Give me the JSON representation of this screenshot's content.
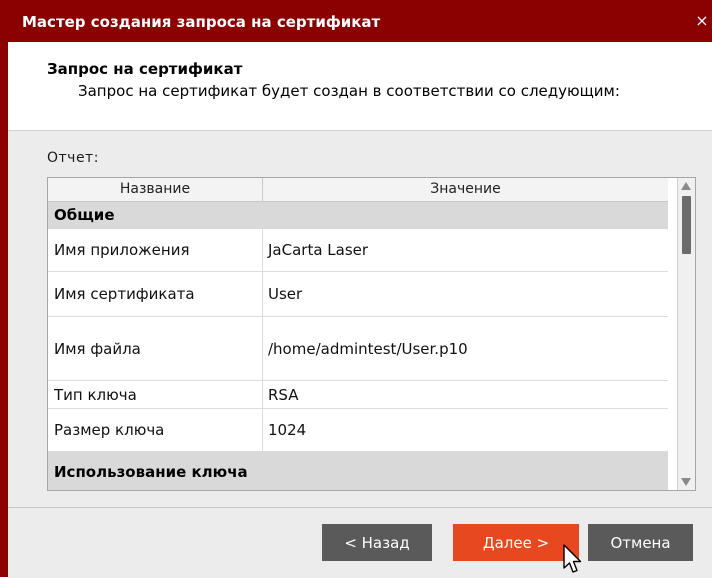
{
  "window": {
    "title": "Мастер создания запроса на сертификат",
    "close_glyph": "×"
  },
  "header": {
    "title": "Запрос на сертификат",
    "subtitle": "Запрос на сертификат будет создан в соответствии со следующим:"
  },
  "report": {
    "label": "Отчет:",
    "columns": [
      "Название",
      "Значение"
    ],
    "groups": [
      {
        "name": "Общие"
      },
      {
        "name": "Использование ключа"
      }
    ],
    "rows": [
      {
        "name": "Имя приложения",
        "value": "JaCarta Laser"
      },
      {
        "name": "Имя сертификата",
        "value": "User"
      },
      {
        "name": "Имя файла",
        "value": "/home/admintest/User.p10"
      },
      {
        "name": "Тип ключа",
        "value": "RSA"
      },
      {
        "name": "Размер ключа",
        "value": "1024"
      }
    ]
  },
  "buttons": {
    "back": "< Назад",
    "next": "Далее >",
    "cancel": "Отмена"
  },
  "colors": {
    "titlebar": "#8b0000",
    "next_button": "#e8481f",
    "secondary_button": "#5a5a5a"
  },
  "icons": {
    "close": "close-icon",
    "cursor": "mouse-pointer-icon",
    "scroll_up": "arrow-up-icon",
    "scroll_down": "arrow-down-icon"
  }
}
